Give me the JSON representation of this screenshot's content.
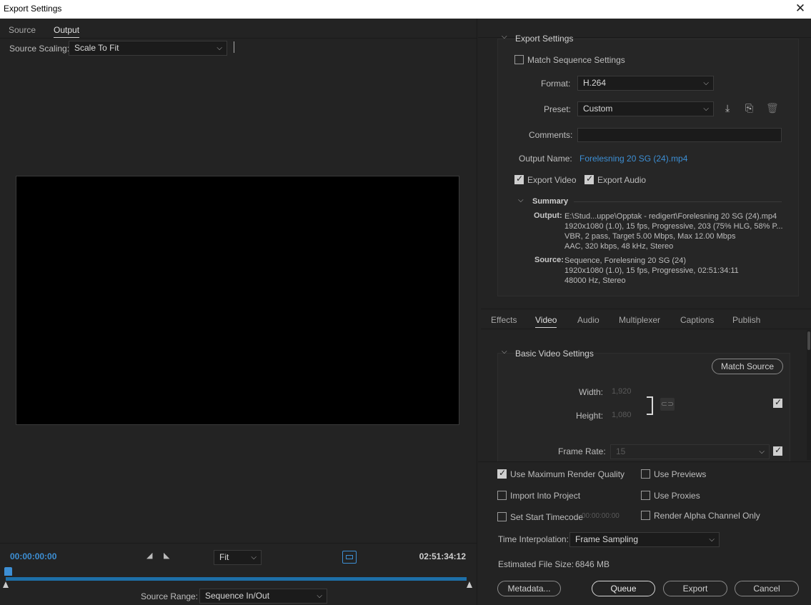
{
  "window": {
    "title": "Export Settings",
    "close_icon": "close-icon"
  },
  "left": {
    "tabs": [
      "Source",
      "Output"
    ],
    "active_tab": "Output",
    "source_scaling_label": "Source Scaling:",
    "source_scaling_value": "Scale To Fit",
    "timecode_start": "00:00:00:00",
    "timecode_end": "02:51:34:12",
    "zoom_value": "Fit",
    "source_range_label": "Source Range:",
    "source_range_value": "Sequence In/Out"
  },
  "export_settings": {
    "header": "Export Settings",
    "match_sequence_label": "Match Sequence Settings",
    "match_sequence_checked": false,
    "format_label": "Format:",
    "format_value": "H.264",
    "preset_label": "Preset:",
    "preset_value": "Custom",
    "comments_label": "Comments:",
    "comments_value": "",
    "output_name_label": "Output Name:",
    "output_name_value": "Forelesning 20 SG (24).mp4",
    "export_video_label": "Export Video",
    "export_video_checked": true,
    "export_audio_label": "Export Audio",
    "export_audio_checked": true,
    "summary_header": "Summary",
    "summary": {
      "output_key": "Output:",
      "output_lines": [
        "E:\\Stud...uppe\\Opptak - redigert\\Forelesning 20 SG (24).mp4",
        "1920x1080 (1.0), 15 fps, Progressive, 203 (75% HLG, 58% P...",
        "VBR, 2 pass, Target 5.00 Mbps, Max 12.00 Mbps",
        "AAC, 320 kbps, 48 kHz, Stereo"
      ],
      "source_key": "Source:",
      "source_lines": [
        "Sequence, Forelesning 20 SG (24)",
        "1920x1080 (1.0), 15 fps, Progressive, 02:51:34:11",
        "48000 Hz, Stereo"
      ]
    }
  },
  "settings_tabs": [
    "Effects",
    "Video",
    "Audio",
    "Multiplexer",
    "Captions",
    "Publish"
  ],
  "active_settings_tab": "Video",
  "video": {
    "header": "Basic Video Settings",
    "match_source_label": "Match Source",
    "width_label": "Width:",
    "width_value": "1,920",
    "height_label": "Height:",
    "height_value": "1,080",
    "frame_rate_label": "Frame Rate:",
    "frame_rate_value": "15"
  },
  "bottom": {
    "use_max_render_label": "Use Maximum Render Quality",
    "use_max_render_checked": true,
    "use_previews_label": "Use Previews",
    "import_into_project_label": "Import Into Project",
    "use_proxies_label": "Use Proxies",
    "set_start_timecode_label": "Set Start Timecode",
    "start_timecode_value": "00:00:00:00",
    "render_alpha_label": "Render Alpha Channel Only",
    "time_interpolation_label": "Time Interpolation:",
    "time_interpolation_value": "Frame Sampling",
    "estimated_size_label": "Estimated File Size:",
    "estimated_size_value": "6846 MB",
    "metadata_label": "Metadata...",
    "queue_label": "Queue",
    "export_label": "Export",
    "cancel_label": "Cancel"
  },
  "colors": {
    "accent_blue": "#1d6fa8",
    "link_blue": "#3d8fd4",
    "background": "#232323"
  }
}
